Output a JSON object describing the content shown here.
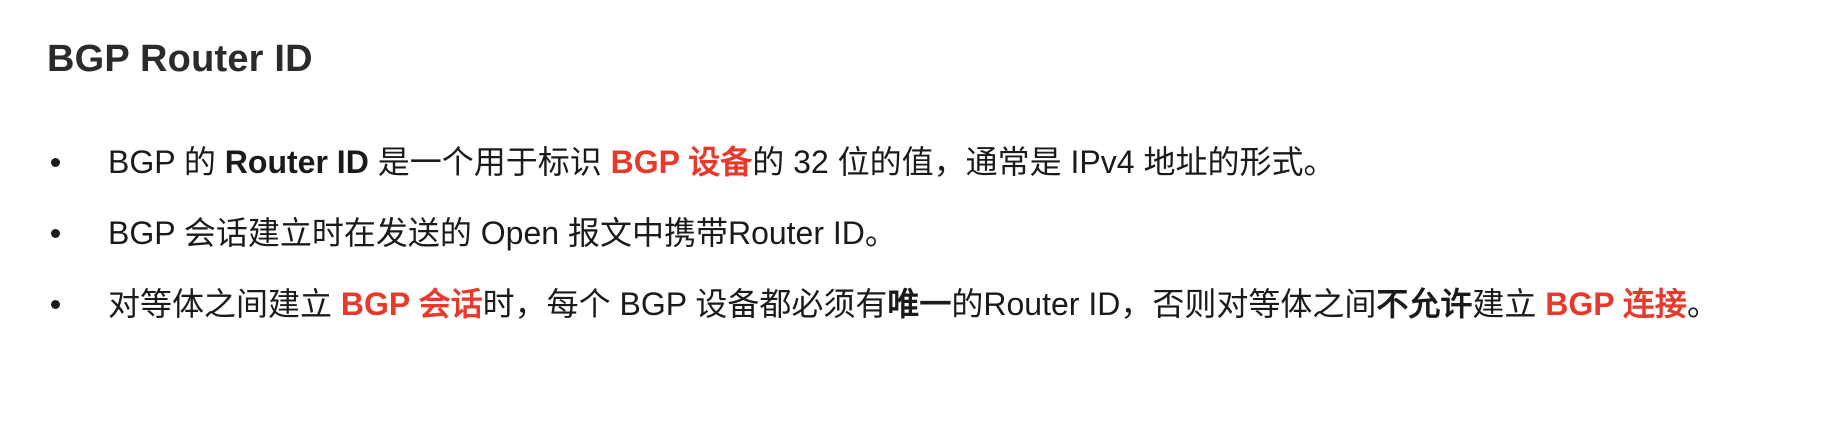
{
  "heading": "BGP Router ID",
  "colors": {
    "text": "#1a1a1a",
    "emphasis_red": "#e8392b"
  },
  "bullets": [
    {
      "segments": [
        {
          "text": "BGP 的 ",
          "style": "normal"
        },
        {
          "text": "Router ID",
          "style": "bold"
        },
        {
          "text": " 是一个用于标识 ",
          "style": "normal"
        },
        {
          "text": "BGP 设备",
          "style": "red"
        },
        {
          "text": "的 32 位的值，通常是 IPv4 地址的形式。",
          "style": "normal"
        }
      ]
    },
    {
      "segments": [
        {
          "text": "BGP 会话建立时在发送的 Open 报文中携带Router ID。",
          "style": "normal"
        }
      ]
    },
    {
      "segments": [
        {
          "text": "对等体之间建立 ",
          "style": "normal"
        },
        {
          "text": "BGP 会话",
          "style": "red"
        },
        {
          "text": "时，每个 BGP 设备都必须有",
          "style": "normal"
        },
        {
          "text": "唯一",
          "style": "bold"
        },
        {
          "text": "的Router ID，否则对等体之间",
          "style": "normal"
        },
        {
          "text": "不允许",
          "style": "bold"
        },
        {
          "text": "建立 ",
          "style": "normal"
        },
        {
          "text": "BGP 连接",
          "style": "red"
        },
        {
          "text": "。",
          "style": "normal"
        }
      ]
    }
  ]
}
